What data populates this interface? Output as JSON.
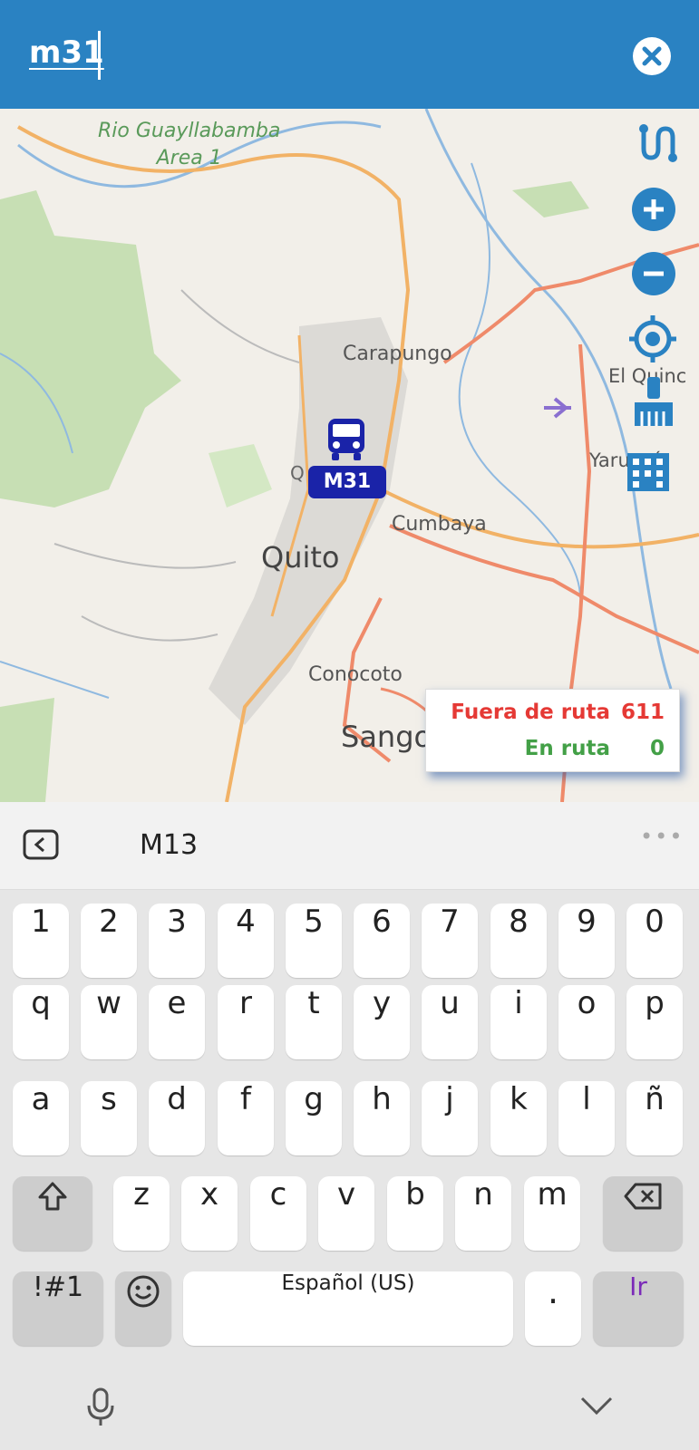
{
  "search": {
    "query": "m31",
    "clear_icon": "close-circle-icon"
  },
  "map": {
    "labels": {
      "area": "Rio Guayllabamba\nArea 1",
      "carapungo": "Carapungo",
      "el_quinche": "El Quinc",
      "yaruqui": "Yaruquí",
      "cumbaya": "Cumbaya",
      "quito": "Quito",
      "conocoto": "Conocoto",
      "sangolqui": "Sango",
      "q": "Q"
    },
    "controls": [
      "route-icon",
      "zoom-in-icon",
      "zoom-out-icon",
      "locate-icon",
      "clean-icon",
      "building-icon"
    ],
    "bus_marker": {
      "label": "M31",
      "icon": "bus-icon",
      "color": "#1a23a8"
    },
    "status": {
      "off_route_label": "Fuera de ruta",
      "off_route_value": "611",
      "off_route_color": "#e53935",
      "on_route_label": "En ruta",
      "on_route_value": "0",
      "on_route_color": "#43a047"
    }
  },
  "suggestions": {
    "back_icon": "chevron-left-icon",
    "word": "M13",
    "more": "•••"
  },
  "keyboard": {
    "row1": [
      "1",
      "2",
      "3",
      "4",
      "5",
      "6",
      "7",
      "8",
      "9",
      "0"
    ],
    "row2": [
      "q",
      "w",
      "e",
      "r",
      "t",
      "y",
      "u",
      "i",
      "o",
      "p"
    ],
    "row3": [
      "a",
      "s",
      "d",
      "f",
      "g",
      "h",
      "j",
      "k",
      "l",
      "ñ"
    ],
    "row4": [
      "z",
      "x",
      "c",
      "v",
      "b",
      "n",
      "m"
    ],
    "symbols": "!#1",
    "space": "Español (US)",
    "period": ".",
    "go": "Ir",
    "go_color": "#7b2ab8",
    "shift_icon": "shift-icon",
    "backspace_icon": "backspace-icon",
    "emoji_icon": "emoji-icon",
    "mic_icon": "microphone-icon",
    "hide_icon": "chevron-down-icon"
  }
}
